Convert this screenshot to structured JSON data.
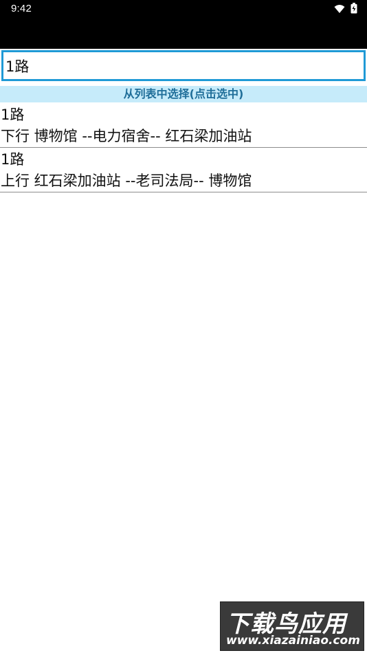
{
  "status_bar": {
    "time": "9:42",
    "icons": [
      "wifi-icon",
      "battery-icon"
    ]
  },
  "search": {
    "value": "1路",
    "accent_color": "#1f9ad6"
  },
  "hint": {
    "text": "从列表中选择(点击选中)",
    "bg_color": "#c6ebfa",
    "text_color": "#1f6e99"
  },
  "routes": [
    {
      "name": "1路",
      "desc": "下行 博物馆 --电力宿舍-- 红石梁加油站"
    },
    {
      "name": "1路",
      "desc": "上行 红石梁加油站 --老司法局-- 博物馆"
    }
  ],
  "watermark": {
    "title": "下载鸟应用",
    "url": "www.xiazainiao.com"
  }
}
